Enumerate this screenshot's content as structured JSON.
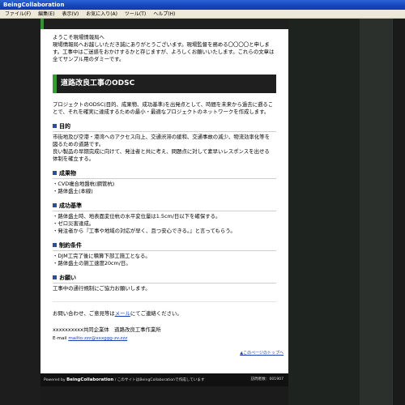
{
  "window": {
    "title": "BeingCollaboration"
  },
  "menu": [
    "ファイル(F)",
    "編集(E)",
    "表示(V)",
    "お気に入り(A)",
    "ツール(T)",
    "ヘルプ(H)"
  ],
  "intro": {
    "line1": "ようこそ現場情報局へ",
    "line2": "現場情報局へお越しいただき誠にありがとうございます。現場監督を務める〇〇〇〇と申しま",
    "line3": "す。工事中はご迷惑をおかけするかと存じますが、よろしくお願いいたします。これらの文章は",
    "line4": "全てサンプル用のダミーです。"
  },
  "section": {
    "title": "道路改良工事のODSC"
  },
  "odsc": {
    "line1": "プロジェクトのODSC(目的、成果物、成功基準)を出発点として、時間を未来から過去に遡るこ",
    "line2": "とで、それを確実に達成するための最小・最適なプロジェクトのネットワークを作成します。"
  },
  "purpose": {
    "heading": "目的",
    "line1": "市街地及び空港・港湾へのアクセス向上、交通渋滞の緩和、交通事故の減少、物流効率化等を",
    "line2": "図るための道路です。",
    "line3": "良い製品の早期完成に向けて、発注者と共に考え、問題点に対して素早いレスポンスを出せる",
    "line4": "体制を確立する。"
  },
  "deliverables": {
    "heading": "成果物",
    "items": [
      "・CVD複合地盤杭(鋼管杭)",
      "・路体盛土(本線)"
    ]
  },
  "criteria": {
    "heading": "成功基準",
    "items": [
      "・路体盛土時、地表面変位杭の水平変位量は1.5cm/日以下を確保する。",
      "・ゼロ災害達成。",
      "・発注者から『工事や地域の対応が早く、且つ安心できる。』と言ってもらう。"
    ]
  },
  "constraints": {
    "heading": "制約条件",
    "items": [
      "・DJM工完了後に積算下部工施工となる。",
      "・路体盛土の施工速度20cm/日。"
    ]
  },
  "request": {
    "heading": "お願い",
    "text": "工事中の通行規制にご協力お願いします。"
  },
  "contact": {
    "before": "お問い合わせ、ご意見等は",
    "link": "メール",
    "after": "にてご連絡ください。",
    "org": "xxxxxxxxxx共同企業体　道路改良工事作業所",
    "email_label": "E-mail",
    "email": "mailto:zzz@xxxggg-zv.zzz"
  },
  "backtop": "▲このページのトップへ",
  "footer": {
    "powered": "Powered by",
    "brand": "BeingCollaboration",
    "note": "/ このサイトはBeingCollaborationで作成しています",
    "counter": "訪問者数：001907"
  }
}
